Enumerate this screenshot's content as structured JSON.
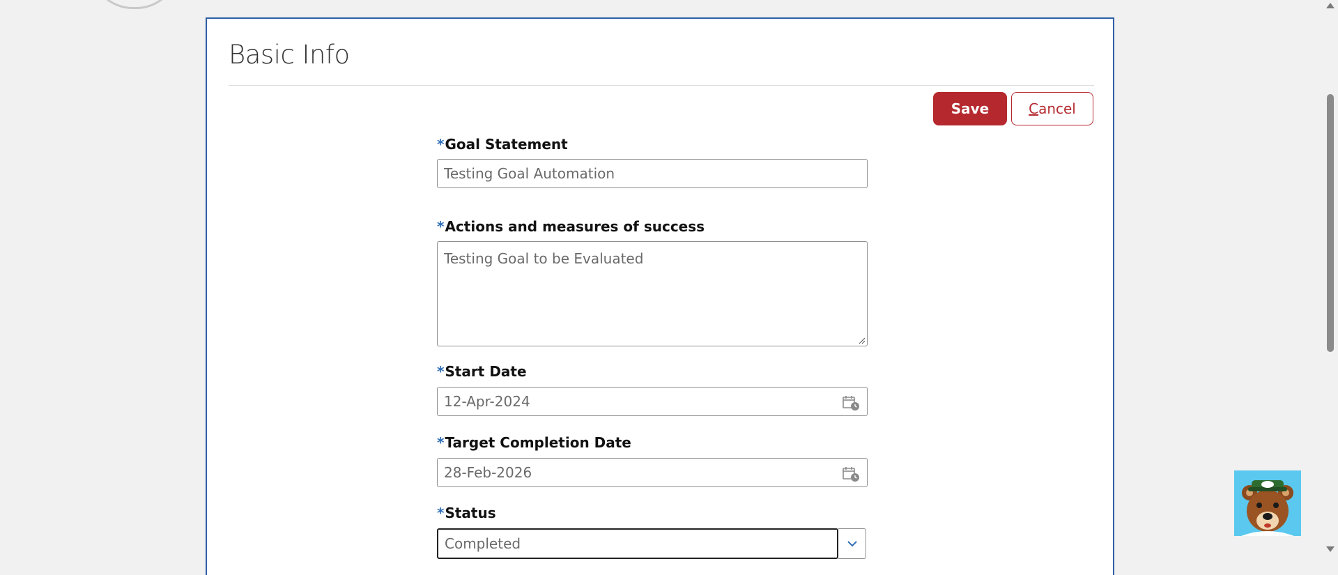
{
  "panel": {
    "title": "Basic Info",
    "save_label": "Save",
    "cancel_first_letter": "C",
    "cancel_rest": "ancel"
  },
  "fields": {
    "goal_statement": {
      "label": "Goal Statement",
      "value": "Testing Goal Automation"
    },
    "actions": {
      "label": "Actions and measures of success",
      "value": "Testing Goal to be Evaluated"
    },
    "start_date": {
      "label": "Start Date",
      "value": "12-Apr-2024"
    },
    "target_date": {
      "label": "Target Completion Date",
      "value": "28-Feb-2026"
    },
    "status": {
      "label": "Status",
      "value": "Completed"
    }
  },
  "required_marker": "*",
  "icons": {
    "calendar": "calendar-icon",
    "dropdown": "chevron-down-icon",
    "assistant": "bear-mascot-icon"
  },
  "colors": {
    "primary": "#b4282e",
    "required": "#2f6fb8",
    "panel_border": "#2f5fa6",
    "mascot_bg": "#5bc8ef"
  }
}
